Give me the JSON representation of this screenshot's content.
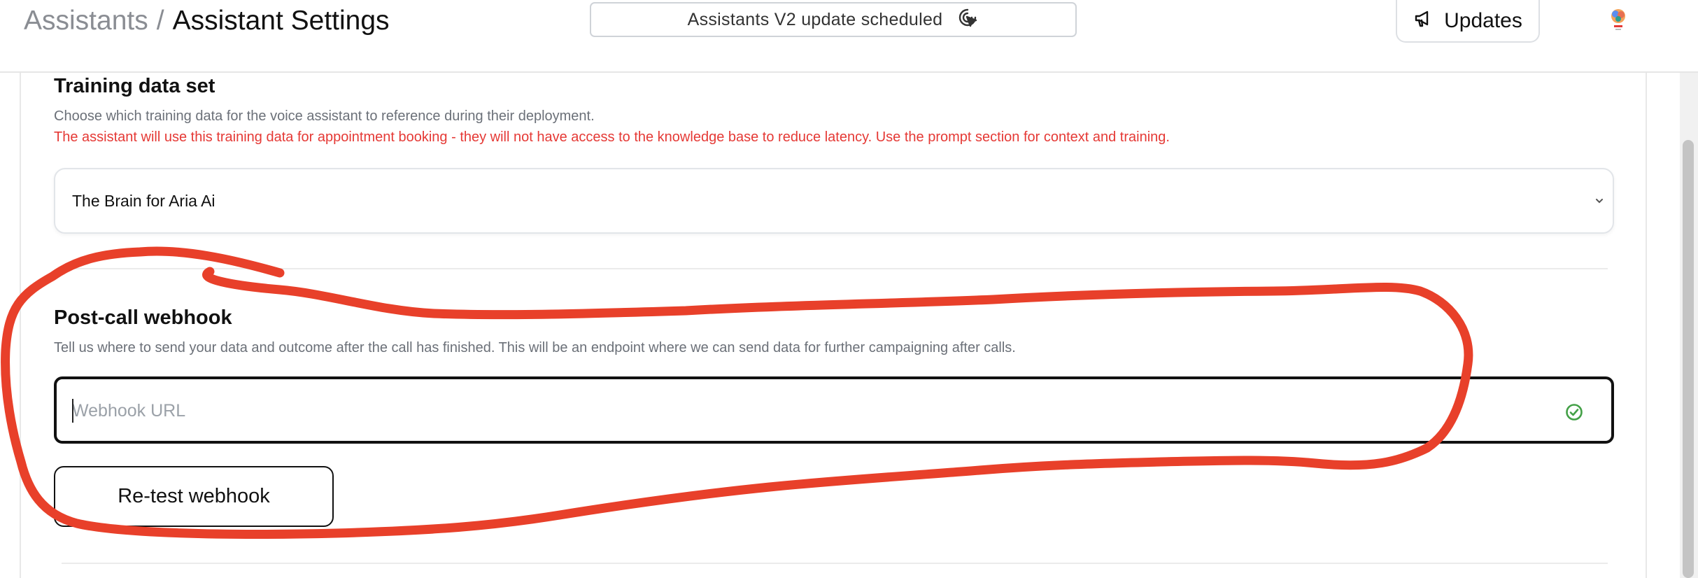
{
  "header": {
    "breadcrumb_parent": "Assistants",
    "breadcrumb_separator": "/",
    "breadcrumb_current": "Assistant Settings",
    "notice_text": "Assistants V2 update scheduled",
    "notice_icon": "cursor-click-icon",
    "updates_label": "Updates",
    "updates_icon": "megaphone-icon"
  },
  "training": {
    "title": "Training data set",
    "description": "Choose which training data for the voice assistant to reference during their deployment.",
    "warning": "The assistant will use this training data for appointment booking - they will not have access to the knowledge base to reduce latency. Use the prompt section for context and training.",
    "selected_value": "The Brain for Aria Ai"
  },
  "webhook": {
    "title": "Post-call webhook",
    "description": "Tell us where to send your data and outcome after the call has finished. This will be an endpoint where we can send data for further campaigning after calls.",
    "placeholder": "Webhook URL",
    "value": "",
    "status_icon": "check-circle-icon",
    "retest_label": "Re-test webhook"
  },
  "colors": {
    "warning": "#e53935",
    "success": "#43a047",
    "annotation": "#e8402a"
  }
}
